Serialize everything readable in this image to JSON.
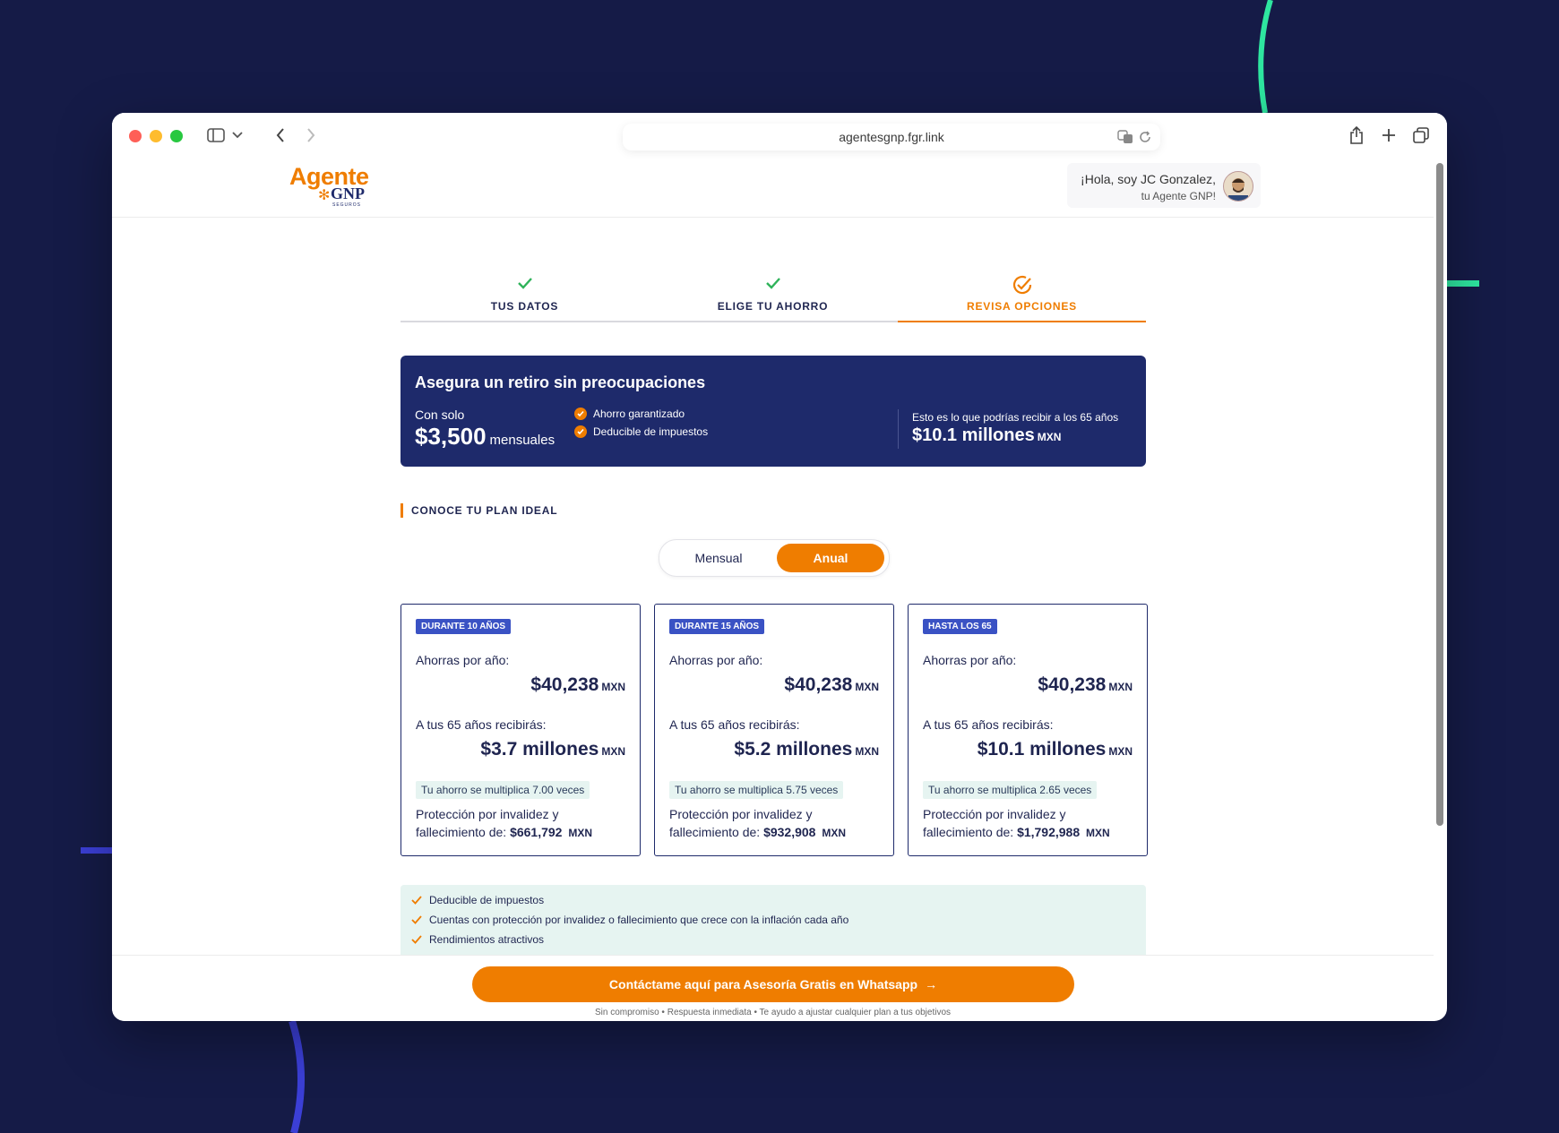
{
  "browser": {
    "url": "agentesgnp.fgr.link"
  },
  "header": {
    "logo_text": "Agente",
    "logo_brand": "GNP",
    "logo_sub": "SEGUROS",
    "agent_greeting": "¡Hola, soy JC Gonzalez,",
    "agent_sub": "tu Agente GNP!"
  },
  "stepper": {
    "steps": [
      {
        "label": "TUS DATOS",
        "state": "done"
      },
      {
        "label": "ELIGE TU AHORRO",
        "state": "done"
      },
      {
        "label": "REVISA OPCIONES",
        "state": "active"
      }
    ]
  },
  "hero": {
    "title": "Asegura un retiro sin preocupaciones",
    "con_label": "Con solo",
    "amount": "$3,500",
    "period": "mensuales",
    "bullets": [
      "Ahorro garantizado",
      "Deducible de impuestos"
    ],
    "right_text": "Esto es lo que podrías recibir a los 65 años",
    "right_value": "$10.1 millones",
    "right_currency": "MXN"
  },
  "section_title": "CONOCE TU PLAN IDEAL",
  "toggle": {
    "options": [
      "Mensual",
      "Anual"
    ],
    "selected": "Anual"
  },
  "plans": [
    {
      "tag": "DURANTE 10 AÑOS",
      "save_label": "Ahorras por año:",
      "save_value": "$40,238",
      "currency": "MXN",
      "receive_label": "A tus 65 años recibirás:",
      "receive_value": "$3.7 millones",
      "multiplier": "Tu ahorro se multiplica 7.00 veces",
      "protection_label_1": "Protección por invalidez y",
      "protection_label_2": "fallecimiento de:",
      "protection_value": "$661,792"
    },
    {
      "tag": "DURANTE 15 AÑOS",
      "save_label": "Ahorras por año:",
      "save_value": "$40,238",
      "currency": "MXN",
      "receive_label": "A tus 65 años recibirás:",
      "receive_value": "$5.2 millones",
      "multiplier": "Tu ahorro se multiplica 5.75 veces",
      "protection_label_1": "Protección por invalidez y",
      "protection_label_2": "fallecimiento de:",
      "protection_value": "$932,908"
    },
    {
      "tag": "HASTA LOS 65",
      "save_label": "Ahorras por año:",
      "save_value": "$40,238",
      "currency": "MXN",
      "receive_label": "A tus 65 años recibirás:",
      "receive_value": "$10.1 millones",
      "multiplier": "Tu ahorro se multiplica 2.65 veces",
      "protection_label_1": "Protección por invalidez y",
      "protection_label_2": "fallecimiento de:",
      "protection_value": "$1,792,988"
    }
  ],
  "benefits": [
    "Deducible de impuestos",
    "Cuentas con protección por invalidez o fallecimiento que crece con la inflación cada año",
    "Rendimientos atractivos"
  ],
  "cta": {
    "label": "Contáctame aquí para Asesoría Gratis en Whatsapp",
    "arrow": "→",
    "note": "Sin compromiso • Respuesta inmediata • Te ayudo a ajustar cualquier plan a tus objetivos"
  },
  "colors": {
    "accent": "#ef7d00",
    "navy": "#1e2a6b",
    "success": "#2fb35a",
    "tag_blue": "#3a52c4",
    "mint": "#e6f4f1",
    "background": "#151b47"
  }
}
